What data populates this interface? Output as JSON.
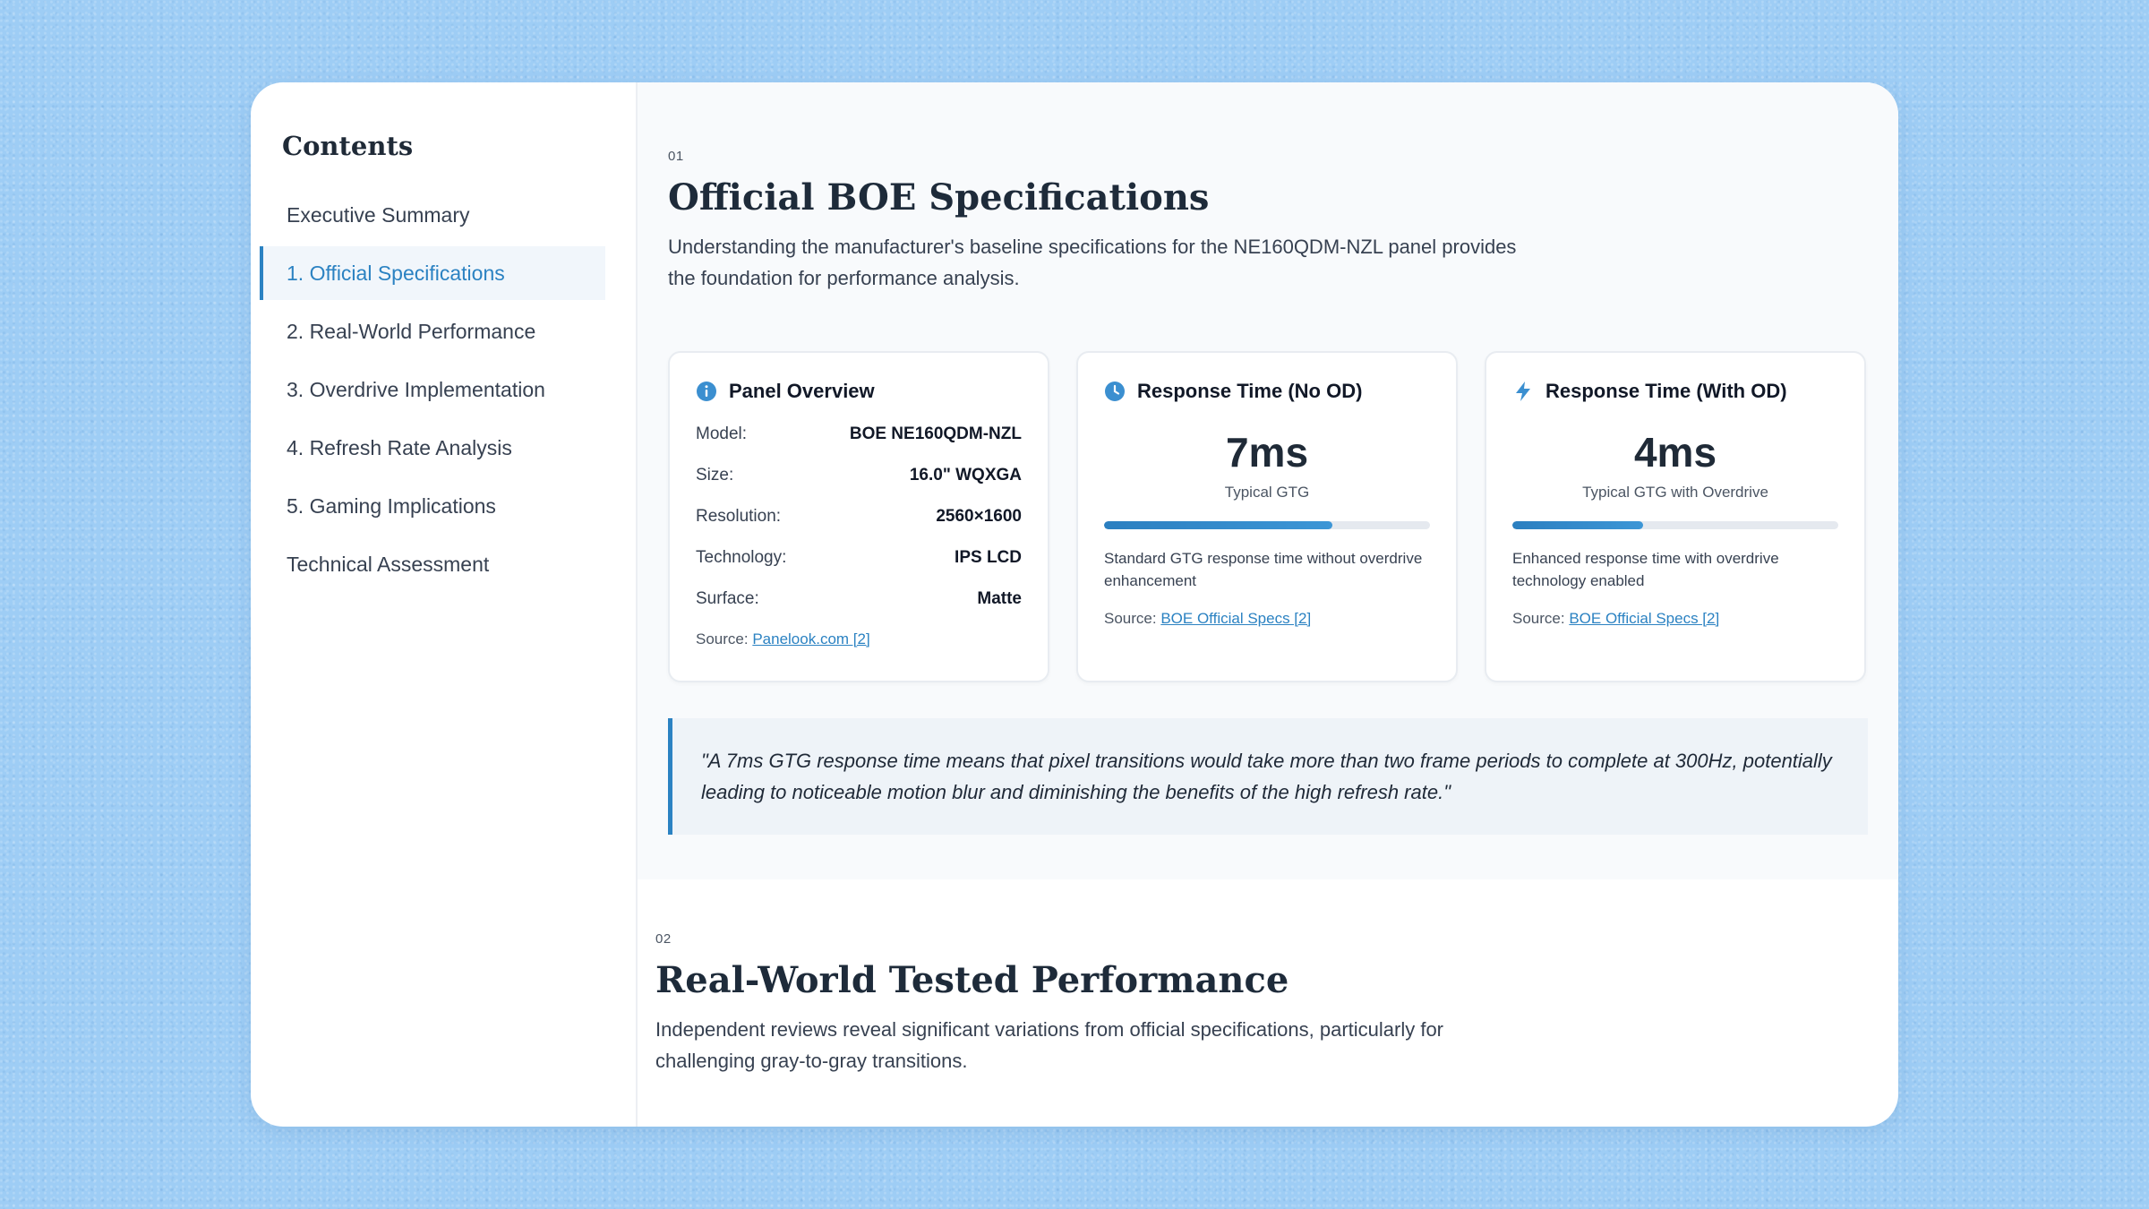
{
  "sidebar": {
    "title": "Contents",
    "items": [
      {
        "label": "Executive Summary"
      },
      {
        "label": "1. Official Specifications"
      },
      {
        "label": "2. Real-World Performance"
      },
      {
        "label": "3. Overdrive Implementation"
      },
      {
        "label": "4. Refresh Rate Analysis"
      },
      {
        "label": "5. Gaming Implications"
      },
      {
        "label": "Technical Assessment"
      }
    ],
    "active_index": 1
  },
  "section1": {
    "number": "01",
    "title": "Official BOE Specifications",
    "description": "Understanding the manufacturer's baseline specifications for the NE160QDM-NZL panel provides the foundation for performance analysis.",
    "panel_overview": {
      "icon": "info-icon",
      "title": "Panel Overview",
      "rows": [
        {
          "label": "Model:",
          "value": "BOE NE160QDM-NZL"
        },
        {
          "label": "Size:",
          "value": "16.0\" WQXGA"
        },
        {
          "label": "Resolution:",
          "value": "2560×1600"
        },
        {
          "label": "Technology:",
          "value": "IPS LCD"
        },
        {
          "label": "Surface:",
          "value": "Matte"
        }
      ],
      "source_prefix": "Source:",
      "source_link": "Panelook.com [2]"
    },
    "response_no_od": {
      "icon": "clock-icon",
      "title": "Response Time (No OD)",
      "value": "7ms",
      "subtitle": "Typical GTG",
      "progress": 0.7,
      "description": "Standard GTG response time without overdrive enhancement",
      "source_prefix": "Source:",
      "source_link": "BOE Official Specs [2]"
    },
    "response_with_od": {
      "icon": "bolt-icon",
      "title": "Response Time (With OD)",
      "value": "4ms",
      "subtitle": "Typical GTG with Overdrive",
      "progress": 0.4,
      "description": "Enhanced response time with overdrive technology enabled",
      "source_prefix": "Source:",
      "source_link": "BOE Official Specs [2]"
    },
    "quote": "\"A 7ms GTG response time means that pixel transitions would take more than two frame periods to complete at 300Hz, potentially leading to noticeable motion blur and diminishing the benefits of the high refresh rate.\""
  },
  "section2": {
    "number": "02",
    "title": "Real-World Tested Performance",
    "description": "Independent reviews reveal significant variations from official specifications, particularly for challenging gray-to-gray transitions."
  },
  "colors": {
    "accent": "#2b82c2",
    "background": "#9ecdf5",
    "title": "#1e2b3a"
  }
}
